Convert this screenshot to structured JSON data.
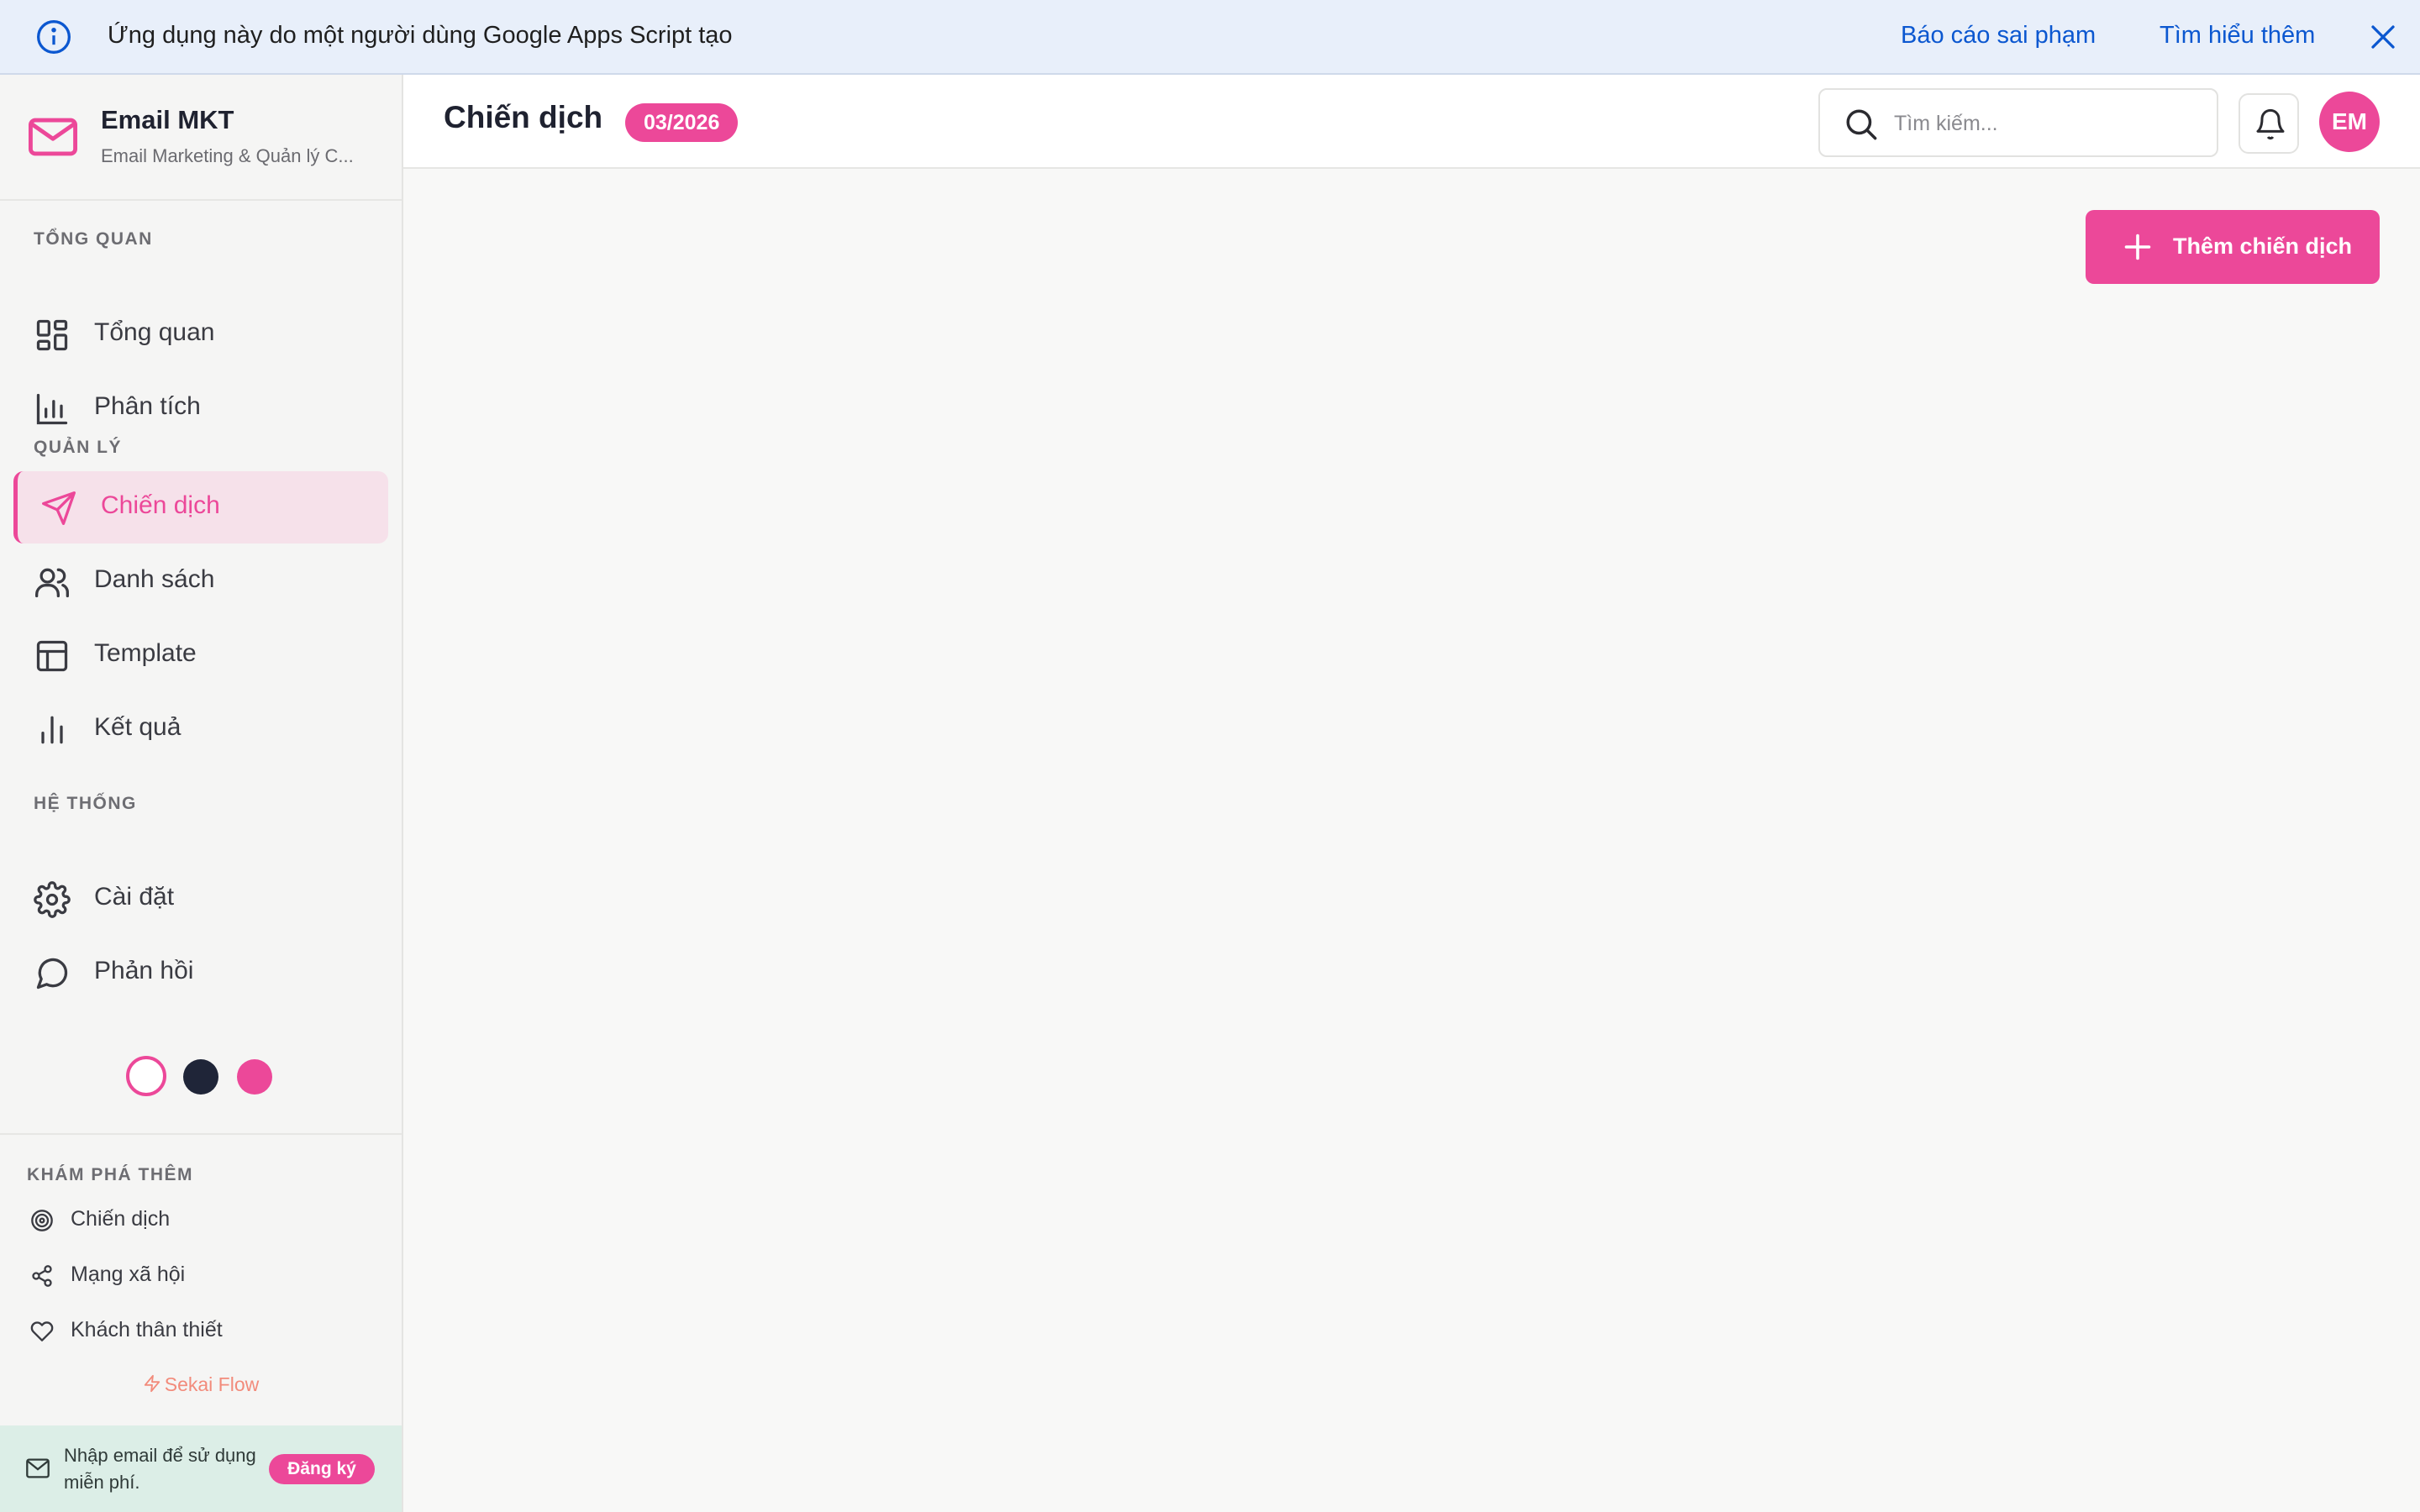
{
  "banner": {
    "message": "Ứng dụng này do một người dùng Google Apps Script tạo",
    "report_link": "Báo cáo sai phạm",
    "learn_link": "Tìm hiểu thêm"
  },
  "brand": {
    "name": "Email MKT",
    "subtitle": "Email Marketing & Quản lý C..."
  },
  "sidebar": {
    "sections": [
      {
        "label": "TỔNG QUAN",
        "items": [
          {
            "label": "Tổng quan",
            "icon": "dashboard-icon"
          },
          {
            "label": "Phân tích",
            "icon": "analytics-icon"
          }
        ]
      },
      {
        "label": "QUẢN LÝ",
        "items": [
          {
            "label": "Chiến dịch",
            "icon": "send-icon",
            "active": true
          },
          {
            "label": "Danh sách",
            "icon": "users-icon"
          },
          {
            "label": "Template",
            "icon": "template-icon"
          },
          {
            "label": "Kết quả",
            "icon": "bar-chart-icon"
          }
        ]
      },
      {
        "label": "HỆ THỐNG",
        "items": [
          {
            "label": "Cài đặt",
            "icon": "gear-icon"
          },
          {
            "label": "Phản hồi",
            "icon": "chat-bubble-icon"
          }
        ]
      }
    ],
    "theme_colors": [
      "#ffffff",
      "#1f2538",
      "#ec4899"
    ]
  },
  "explore": {
    "label": "KHÁM PHÁ THÊM",
    "items": [
      {
        "label": "Chiến dịch",
        "icon": "target-icon"
      },
      {
        "label": "Mạng xã hội",
        "icon": "share-icon"
      },
      {
        "label": "Khách thân thiết",
        "icon": "heart-icon"
      }
    ],
    "credit": "Sekai Flow"
  },
  "signup": {
    "text": "Nhập email để sử dụng miễn phí.",
    "button": "Đăng ký"
  },
  "header": {
    "title": "Chiến dịch",
    "badge": "03/2026",
    "search_placeholder": "Tìm kiếm...",
    "avatar_initials": "EM"
  },
  "main": {
    "add_button": "Thêm chiến dịch"
  },
  "colors": {
    "accent": "#ec4899",
    "link": "#0b57d0"
  }
}
